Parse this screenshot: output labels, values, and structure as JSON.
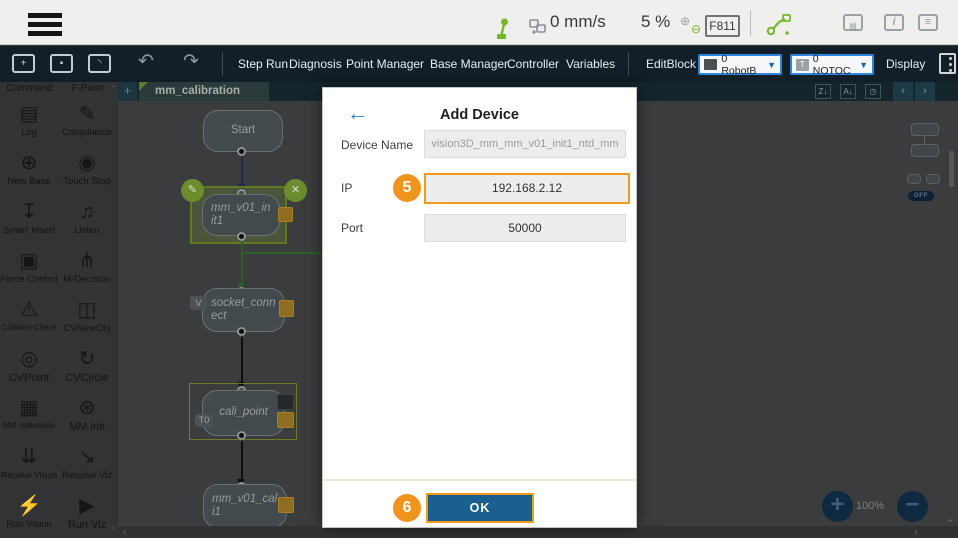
{
  "topbar": {
    "speed": "0 mm/s",
    "percent": "5 %",
    "frame": "F811",
    "plus_glyph": "⊕",
    "minus_glyph": "⊖",
    "info_glyph": "i",
    "doc_glyph": "≡",
    "kbd_glyph": "▤"
  },
  "toolbar": {
    "file_new": "+",
    "file_save": "▪",
    "file_open": "◝",
    "undo": "↶",
    "redo": "↷",
    "items": [
      "Step Run",
      "Diagnosis",
      "Point Manager",
      "Base Manager",
      "Controller",
      "Variables"
    ],
    "editblock": "EditBlock",
    "robot_dropdown": "0 RobotB",
    "tool_badge": "T",
    "tool_dropdown": "0 NOTOC",
    "dd_arrow": "▼",
    "display": "Display"
  },
  "sidebar": {
    "cut_left": "Command",
    "cut_right": "F-Point",
    "items": [
      {
        "label": "Log",
        "glyph": "▤"
      },
      {
        "label": "Compliance",
        "glyph": "✎"
      },
      {
        "label": "New Base",
        "glyph": "⊕"
      },
      {
        "label": "Touch Stop",
        "glyph": "◉"
      },
      {
        "label": "Smart Insert",
        "glyph": "↧"
      },
      {
        "label": "Listen",
        "glyph": "♫"
      },
      {
        "label": "Force Control",
        "glyph": "▣"
      },
      {
        "label": "M-Decision",
        "glyph": "⋔"
      },
      {
        "label": "Collision Check",
        "glyph": "⚠"
      },
      {
        "label": "CVNewObj",
        "glyph": "◫"
      },
      {
        "label": "CVPoint",
        "glyph": "◎"
      },
      {
        "label": "CVCircle",
        "glyph": "↻"
      },
      {
        "label": "MM calibration",
        "glyph": "▦"
      },
      {
        "label": "MM init",
        "glyph": "⊛"
      },
      {
        "label": "Receive Vision",
        "glyph": "⇊"
      },
      {
        "label": "Receive Viz",
        "glyph": "↘"
      },
      {
        "label": "Run Vision",
        "glyph": "⚡"
      },
      {
        "label": "Run Viz",
        "glyph": "▶"
      }
    ]
  },
  "canvas": {
    "tab": "mm_calibration",
    "tab_plus": "+",
    "sort_za": "Z↓",
    "sort_az": "A↓",
    "sort_time": "◷",
    "nav_prev": "‹",
    "nav_next": "›",
    "tab_dd": "▼",
    "zoom_level": "100%",
    "zoom_in": "+",
    "zoom_out": "−",
    "toggle": "OFF",
    "nodes": {
      "start": "Start",
      "init": "mm_v01_init1",
      "socket": "socket_connect",
      "socket_badge": "V",
      "cali": "cali_point",
      "cali_badge": "T0",
      "cali2": "mm_v01_cali1"
    },
    "edit_glyph": "✎",
    "close_glyph": "✕"
  },
  "modal": {
    "back": "←",
    "title": "Add Device",
    "device_label": "Device Name",
    "device_value": "vision3D_mm_mm_v01_init1_ntd_mm",
    "ip_label": "IP",
    "ip_value": "192.168.2.12",
    "ip_step": "5",
    "port_label": "Port",
    "port_value": "50000",
    "ok": "OK",
    "ok_step": "6"
  },
  "colors": {
    "accent_orange": "#f0941e",
    "ok_blue": "#19608f",
    "link_blue": "#2d7fc1",
    "brand_green": "#76b82a"
  }
}
